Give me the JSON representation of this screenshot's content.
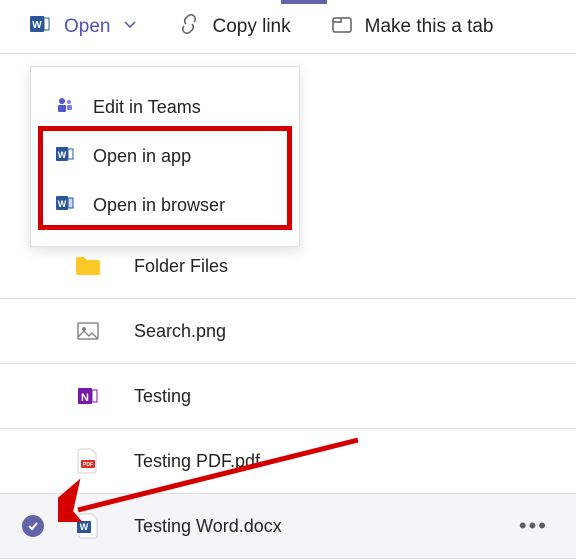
{
  "toolbar": {
    "open_label": "Open",
    "copy_link_label": "Copy link",
    "make_tab_label": "Make this a tab"
  },
  "dropdown": {
    "edit_teams_label": "Edit in Teams",
    "open_app_label": "Open in app",
    "open_browser_label": "Open in browser"
  },
  "files": {
    "0": {
      "name": "Folder Files"
    },
    "1": {
      "name": "Search.png"
    },
    "2": {
      "name": "Testing"
    },
    "3": {
      "name": "Testing PDF.pdf"
    },
    "4": {
      "name": "Testing Word.docx"
    }
  }
}
